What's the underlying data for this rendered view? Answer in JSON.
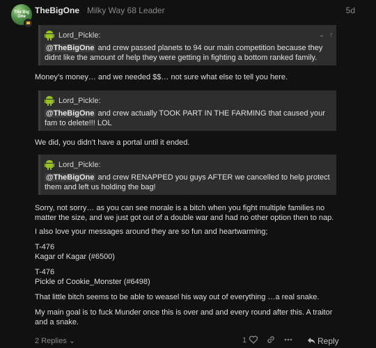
{
  "post": {
    "avatar_text": "The Big One",
    "username": "TheBigOne",
    "user_title": "Milky Way 68 Leader",
    "date": "5d"
  },
  "blocks": [
    {
      "type": "quote",
      "author": "Lord_Pickle:",
      "mention": "@TheBigOne",
      "text": " and crew passed planets to 94 our main competition because they didnt like the amount of help they were getting in fighting a bottom ranked family."
    },
    {
      "type": "para",
      "text": "Money’s money… and we needed $$… not sure what else to tell you here."
    },
    {
      "type": "quote",
      "author": "Lord_Pickle:",
      "mention": "@TheBigOne",
      "text": " and crew actually TOOK PART IN THE FARMING that caused your fam to delete!!! LOL"
    },
    {
      "type": "para",
      "text": "We did, you didn’t have a portal until it ended."
    },
    {
      "type": "quote",
      "author": "Lord_Pickle:",
      "mention": "@TheBigOne",
      "text": " and crew RENAPPED you guys AFTER we cancelled to help protect them and left us holding the bag!"
    },
    {
      "type": "para",
      "text": "Sorry, not sorry… as you can see morale is a bitch when you fight multiple families no matter the size, and we just got out of a double war and had no other option then to nap."
    },
    {
      "type": "para",
      "text": "I also love your messages around they are so fun and heartwarming;"
    },
    {
      "type": "para",
      "lines": [
        "T-476",
        "Kagar of Kagar (#6500)"
      ]
    },
    {
      "type": "para",
      "lines": [
        "T-476",
        "Pickle of Cookie_Monster (#6498)"
      ]
    },
    {
      "type": "para",
      "text": "That little bitch seems to be able to weasel his way out of everything …a real snake."
    },
    {
      "type": "para",
      "text": "My main goal is to fuck Munder once this is over and and every round after this. A traitor and a snake."
    }
  ],
  "quote_controls": "⌄ ↑",
  "footer": {
    "replies_label": "2 Replies ⌄",
    "like_count": "1",
    "reply_label": "Reply"
  },
  "icons": {
    "quote_avatar": "android-icon",
    "like": "heart-icon",
    "link": "link-icon",
    "more": "more-icon",
    "reply": "reply-arrow-icon"
  },
  "colors": {
    "background": "#111111",
    "quote_background": "#2e2e2e",
    "android_green": "#97c024"
  }
}
